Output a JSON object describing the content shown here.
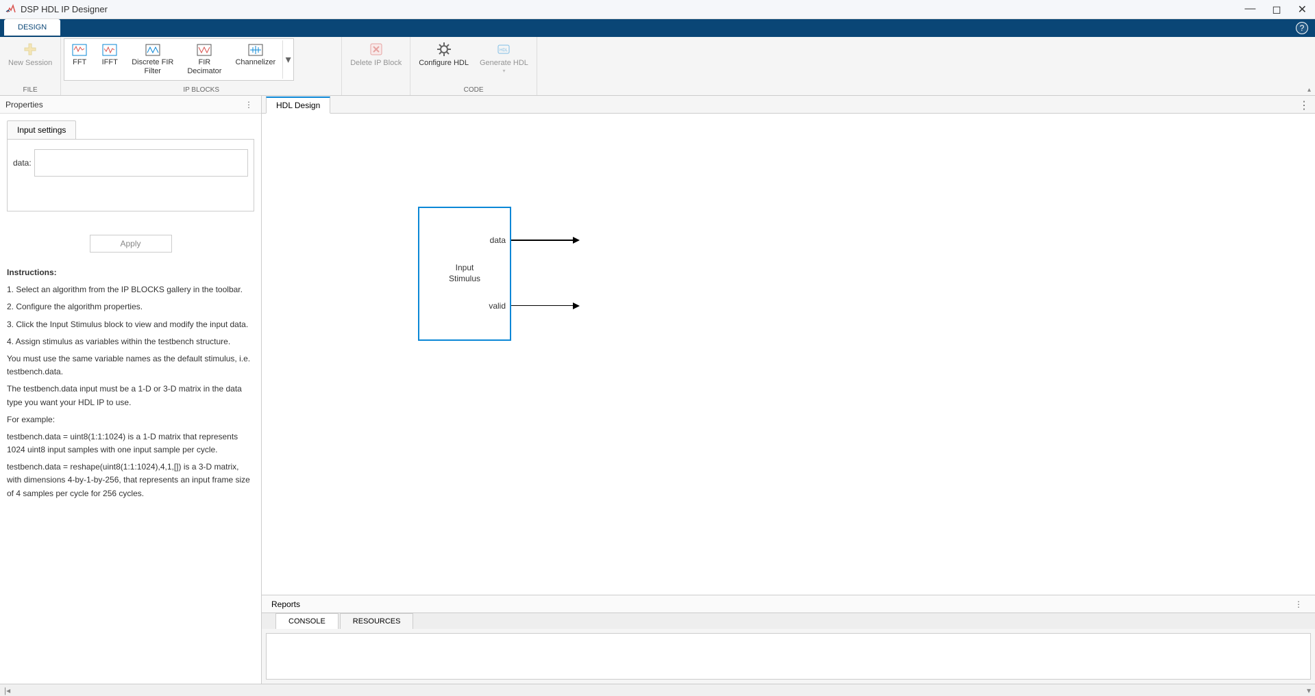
{
  "titlebar": {
    "title": "DSP HDL IP Designer"
  },
  "tabs": {
    "design": "DESIGN"
  },
  "ribbon": {
    "file": {
      "label": "FILE",
      "new_session": "New Session"
    },
    "ipblocks": {
      "label": "IP BLOCKS",
      "items": [
        "FFT",
        "IFFT",
        "Discrete FIR\nFilter",
        "FIR\nDecimator",
        "Channelizer"
      ]
    },
    "delete_ip": "Delete IP Block",
    "code": {
      "label": "CODE",
      "configure": "Configure HDL",
      "generate": "Generate HDL"
    }
  },
  "properties": {
    "header": "Properties",
    "tab": "Input settings",
    "field_label": "data:",
    "apply": "Apply"
  },
  "instructions": {
    "heading": "Instructions:",
    "lines": [
      "1. Select an algorithm from the IP BLOCKS gallery in the toolbar.",
      "2. Configure the algorithm properties.",
      "3. Click the Input Stimulus block to view and modify the input data.",
      "4. Assign stimulus as variables within the testbench structure.",
      "You must use the same variable names as the default stimulus, i.e. testbench.data.",
      "The testbench.data input must be a 1-D or 3-D matrix in the data type you want your HDL IP to use.",
      "For example:",
      "testbench.data = uint8(1:1:1024) is a 1-D matrix that represents 1024 uint8 input samples with one input sample per cycle.",
      "testbench.data = reshape(uint8(1:1:1024),4,1,[]) is a 3-D matrix, with dimensions 4-by-1-by-256, that represents an input frame size of 4 samples per cycle for 256 cycles."
    ]
  },
  "design": {
    "tab": "HDL Design",
    "block_title": "Input\nStimulus",
    "ports": [
      "data",
      "valid"
    ]
  },
  "reports": {
    "header": "Reports",
    "tabs": [
      "CONSOLE",
      "RESOURCES"
    ]
  }
}
